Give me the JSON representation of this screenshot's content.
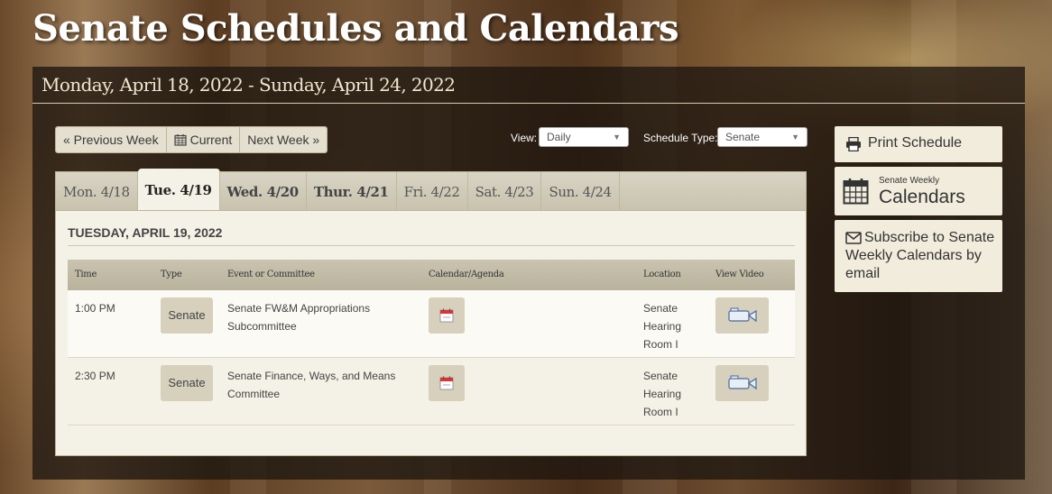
{
  "page": {
    "title": "Senate Schedules and Calendars"
  },
  "week": {
    "range": "Monday, April 18, 2022 - Sunday, April 24, 2022"
  },
  "nav": {
    "previous": "« Previous Week",
    "current": "Current",
    "next": "Next Week »"
  },
  "filters": {
    "view_label": "View:",
    "view_value": "Daily",
    "schedule_type_label": "Schedule Type:",
    "schedule_type_value": "Senate"
  },
  "tabs": [
    {
      "label": "Mon. 4/18"
    },
    {
      "label": "Tue. 4/19",
      "active": true
    },
    {
      "label": "Wed. 4/20"
    },
    {
      "label": "Thur. 4/21"
    },
    {
      "label": "Fri. 4/22"
    },
    {
      "label": "Sat. 4/23"
    },
    {
      "label": "Sun. 4/24"
    }
  ],
  "day": {
    "heading": "TUESDAY, APRIL 19, 2022"
  },
  "table": {
    "headers": [
      "Time",
      "Type",
      "Event or Committee",
      "Calendar/Agenda",
      "Location",
      "View Video"
    ],
    "rows": [
      {
        "time": "1:00 PM",
        "type": "Senate",
        "event_line1": "Senate FW&M Appropriations",
        "event_line2": "Subcommittee",
        "location_line1": "Senate",
        "location_line2": "Hearing",
        "location_line3": "Room I"
      },
      {
        "time": "2:30 PM",
        "type": "Senate",
        "event_line1": "Senate Finance, Ways, and Means",
        "event_line2": "Committee",
        "location_line1": "Senate",
        "location_line2": "Hearing",
        "location_line3": "Room I"
      }
    ]
  },
  "sidebar": {
    "print": "Print Schedule",
    "weekly_small": "Senate Weekly",
    "weekly_large": "Calendars",
    "subscribe_line1": "Subscribe to Senate",
    "subscribe_line2": "Weekly Calendars by",
    "subscribe_line3": "email"
  },
  "icons": {
    "calendar": "calendar-icon",
    "printer": "printer-icon",
    "envelope": "envelope-icon",
    "video": "video-camera-icon"
  },
  "colors": {
    "panel": "#1e160f",
    "tab_bg": "#d9d4c4",
    "content_bg": "#f4f1e6",
    "button_bg": "#d6d0bd",
    "side_button_bg": "#f1ecdc"
  }
}
